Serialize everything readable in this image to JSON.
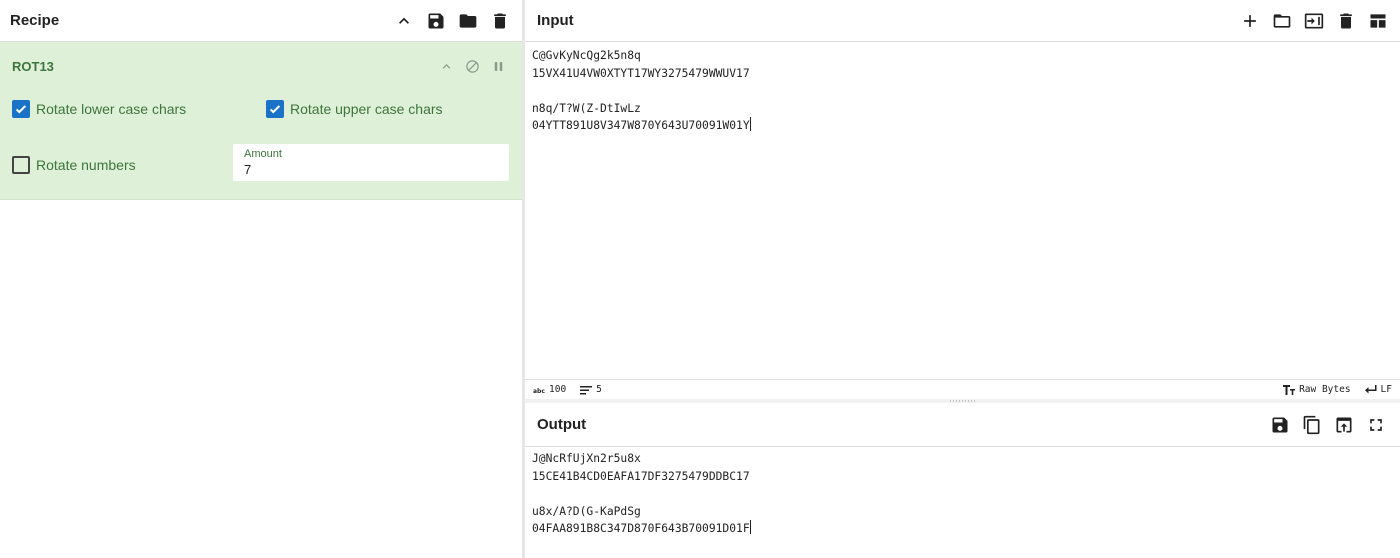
{
  "recipe": {
    "title": "Recipe",
    "operation": {
      "name": "ROT13",
      "options": [
        {
          "label": "Rotate lower case chars",
          "checked": true
        },
        {
          "label": "Rotate upper case chars",
          "checked": true
        },
        {
          "label": "Rotate numbers",
          "checked": false
        }
      ],
      "amount": {
        "label": "Amount",
        "value": "7"
      }
    }
  },
  "input": {
    "title": "Input",
    "lines": [
      "C@GvKyNcQg2k5n8q",
      "15VX41U4VW0XTYT17WY3275479WWUV17",
      "",
      "n8q/T?W(Z-DtIwLz",
      "04YTT891U8V347W870Y643U70091W01Y"
    ],
    "status": {
      "length": "100",
      "lines": "5",
      "encoding": "Raw Bytes",
      "eol": "LF"
    }
  },
  "output": {
    "title": "Output",
    "lines": [
      "J@NcRfUjXn2r5u8x",
      "15CE41B4CD0EAFA17DF3275479DDBC17",
      "",
      "u8x/A?D(G-KaPdSg",
      "04FAA891B8C347D870F643B70091D01F"
    ]
  },
  "colors": {
    "accent": "#1a73c6",
    "op_background": "#dff0d8",
    "op_text": "#3c763d"
  }
}
